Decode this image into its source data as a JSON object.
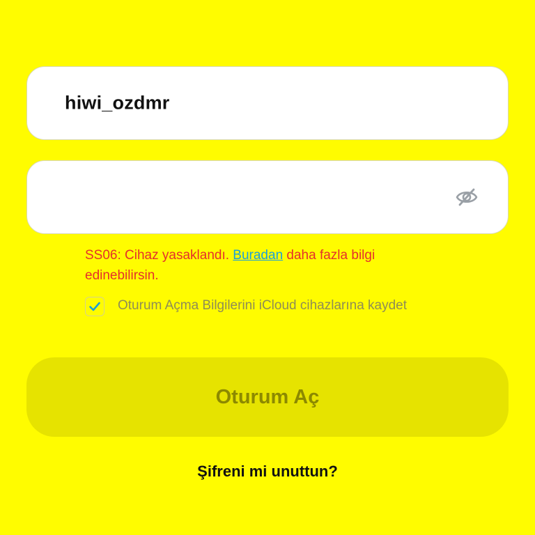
{
  "username_field": {
    "value": "hiwi_ozdmr"
  },
  "password_field": {
    "value": "",
    "visibility_icon": "eye-slash-icon"
  },
  "error": {
    "text_before": "SS06: Cihaz yasaklandı. ",
    "link": "Buradan",
    "text_after": " daha fazla bilgi edinebilirsin."
  },
  "save_credentials": {
    "checked": true,
    "label": "Oturum Açma Bilgilerini iCloud cihazlarına kaydet"
  },
  "login_button": {
    "label": "Oturum Aç"
  },
  "forgot_password": {
    "label": "Şifreni mi unuttun?"
  },
  "colors": {
    "background": "#FFFC00",
    "error": "#E5302B",
    "link": "#1CA0D8",
    "checkmark": "#1CA0D8",
    "disabled_button": "#E6E300",
    "disabled_button_text": "#8C8900"
  }
}
